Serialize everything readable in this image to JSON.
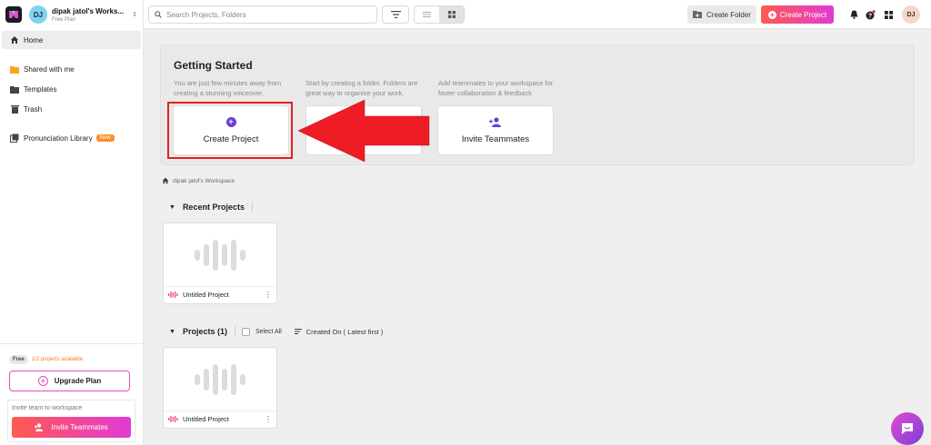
{
  "workspace": {
    "name": "dipak jatol's Works...",
    "plan": "Free Plan",
    "initials": "DJ"
  },
  "sidebar": {
    "items": [
      {
        "label": "Home"
      },
      {
        "label": "Shared with me"
      },
      {
        "label": "Templates"
      },
      {
        "label": "Trash"
      },
      {
        "label": "Pronunciation Library",
        "badge": "New"
      }
    ],
    "free_pill": "Free",
    "projects_available": "1/2 projects available",
    "upgrade_label": "Upgrade Plan",
    "invite_label": "Invite team to workspace",
    "invite_button": "Invite Teammates"
  },
  "topbar": {
    "search_placeholder": "Search Projects, Folders",
    "create_folder": "Create Folder",
    "create_project": "Create Project",
    "user_initials": "DJ"
  },
  "getting_started": {
    "title": "Getting Started",
    "desc1": "You are just few minutes away from creating a stunning voiceover.",
    "desc2": "Start by creating a folder. Folders are great way to organise your work.",
    "desc3": "Add teammates to your workspace for faster collaboration & feedback",
    "card1": "Create Project",
    "card3": "Invite Teammates"
  },
  "breadcrumb": "dipak jatol's Workspace",
  "recent": {
    "header": "Recent Projects",
    "cards": [
      {
        "title": "Untitled Project"
      }
    ]
  },
  "projects": {
    "header": "Projects (1)",
    "select_all": "Select All",
    "sort": "Created On ( Latest first )",
    "cards": [
      {
        "title": "Untitled Project"
      }
    ]
  },
  "colors": {
    "accent_purple": "#6b3fd1",
    "gradient_start": "#ff5a4f",
    "gradient_end": "#e13ad6",
    "annotation_red": "#e32122"
  }
}
